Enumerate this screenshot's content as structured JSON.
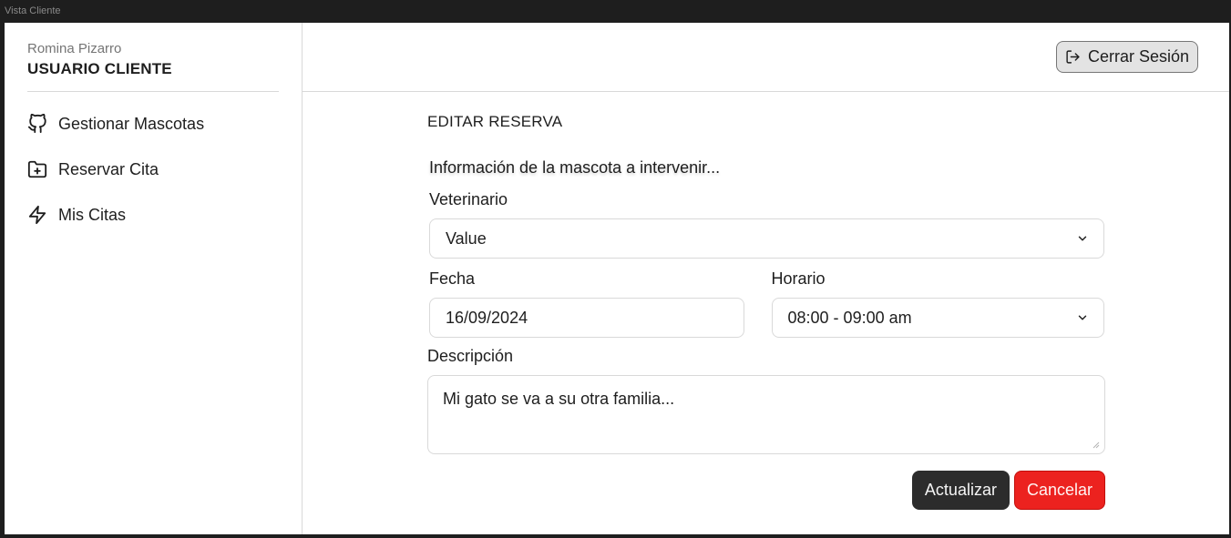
{
  "window": {
    "title": "Vista Cliente"
  },
  "sidebar": {
    "user_name": "Romina Pizarro",
    "user_role": "USUARIO CLIENTE",
    "items": [
      {
        "label": "Gestionar Mascotas",
        "icon": "github-icon"
      },
      {
        "label": "Reservar Cita",
        "icon": "folder-plus-icon"
      },
      {
        "label": "Mis Citas",
        "icon": "zap-icon"
      }
    ]
  },
  "header": {
    "logout_label": "Cerrar Sesión",
    "logout_icon": "log-out-icon"
  },
  "form": {
    "title": "EDITAR RESERVA",
    "subtitle": "Información de la mascota a intervenir...",
    "vet_label": "Veterinario",
    "vet_value": "Value",
    "date_label": "Fecha",
    "date_value": "16/09/2024",
    "time_label": "Horario",
    "time_value": "08:00 - 09:00 am",
    "desc_label": "Descripción",
    "desc_value": "Mi gato se va a su otra familia...",
    "update_label": "Actualizar",
    "cancel_label": "Cancelar"
  },
  "colors": {
    "primary_button": "#2c2c2c",
    "danger_button": "#ec221f",
    "border": "#d9d9d9"
  }
}
